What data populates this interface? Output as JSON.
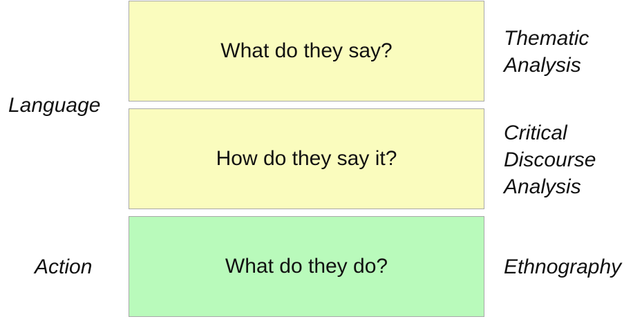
{
  "left_labels": {
    "language": "Language",
    "action": "Action"
  },
  "rows": [
    {
      "question": "What do they say?",
      "method": "Thematic\nAnalysis",
      "color": "#fafcbe"
    },
    {
      "question": "How do they say it?",
      "method": "Critical\nDiscourse\nAnalysis",
      "color": "#fafcbe"
    },
    {
      "question": "What do they do?",
      "method": "Ethnography",
      "color": "#b9fabb"
    }
  ]
}
